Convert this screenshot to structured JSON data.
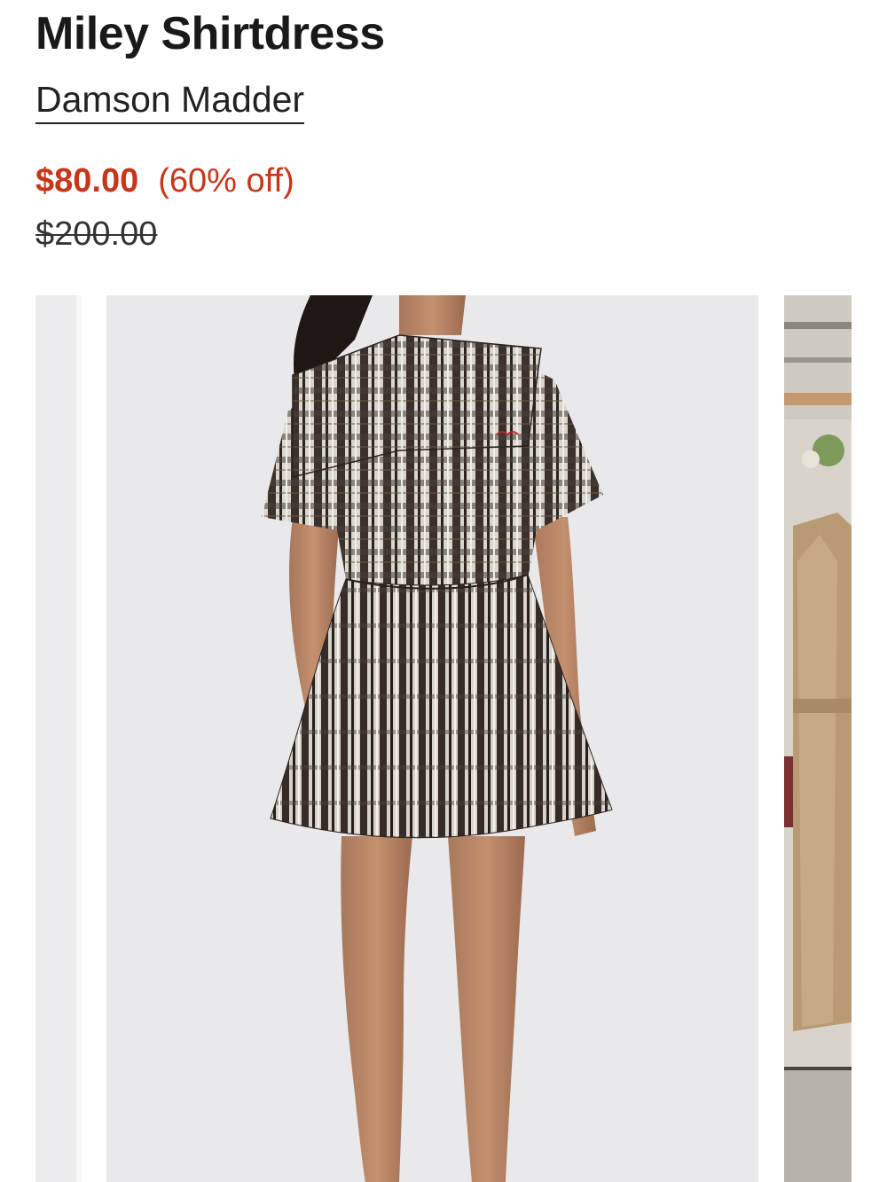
{
  "product": {
    "title": "Miley Shirtdress",
    "brand": "Damson Madder",
    "sale_price": "$80.00",
    "discount": "(60% off)",
    "original_price": "$200.00"
  },
  "colors": {
    "sale": "#c8361a",
    "text": "#191919",
    "image_bg": "#e9e9ec"
  },
  "carousel": {
    "images": [
      {
        "name": "previous-product-image"
      },
      {
        "name": "back-view-plaid-dress-image"
      },
      {
        "name": "next-product-image"
      }
    ]
  }
}
